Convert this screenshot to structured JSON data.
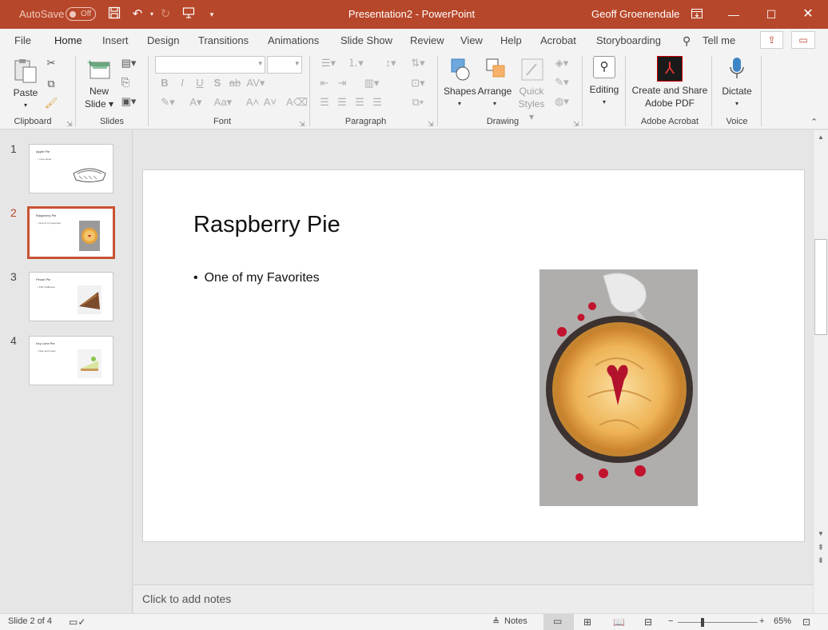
{
  "titlebar": {
    "autosave": "AutoSave",
    "autosave_state": "Off",
    "doc_title": "Presentation2  -  PowerPoint",
    "user": "Geoff Groenendale"
  },
  "tabs": [
    "File",
    "Home",
    "Insert",
    "Design",
    "Transitions",
    "Animations",
    "Slide Show",
    "Review",
    "View",
    "Help",
    "Acrobat",
    "Storyboarding"
  ],
  "tell_me": "Tell me",
  "ribbon": {
    "clipboard": {
      "label": "Clipboard",
      "paste": "Paste"
    },
    "slides": {
      "label": "Slides",
      "new_slide_1": "New",
      "new_slide_2": "Slide"
    },
    "font": {
      "label": "Font"
    },
    "paragraph": {
      "label": "Paragraph"
    },
    "drawing": {
      "label": "Drawing",
      "shapes": "Shapes",
      "arrange": "Arrange",
      "quick_1": "Quick",
      "quick_2": "Styles"
    },
    "editing": {
      "label": "Editing"
    },
    "acrobat": {
      "label": "Adobe Acrobat",
      "btn_1": "Create and Share",
      "btn_2": "Adobe PDF"
    },
    "voice": {
      "label": "Voice",
      "dictate": "Dictate"
    }
  },
  "thumbnails": [
    {
      "num": "1",
      "title": "Apple Pie",
      "bullet": "• I love apple"
    },
    {
      "num": "2",
      "title": "Raspberry Pie",
      "bullet": "• One of my Favorites"
    },
    {
      "num": "3",
      "title": "Pecan Pie",
      "bullet": "• Fall Traditional"
    },
    {
      "num": "4",
      "title": "Key Lime Pie",
      "bullet": "• Nice and Green"
    }
  ],
  "slide": {
    "title": "Raspberry Pie",
    "bullet": "One of my Favorites"
  },
  "notes_placeholder": "Click to add notes",
  "status": {
    "slide_info": "Slide 2 of 4",
    "notes": "Notes",
    "zoom": "65%"
  },
  "colors": {
    "accent": "#b7472a",
    "selection": "#c75232"
  }
}
